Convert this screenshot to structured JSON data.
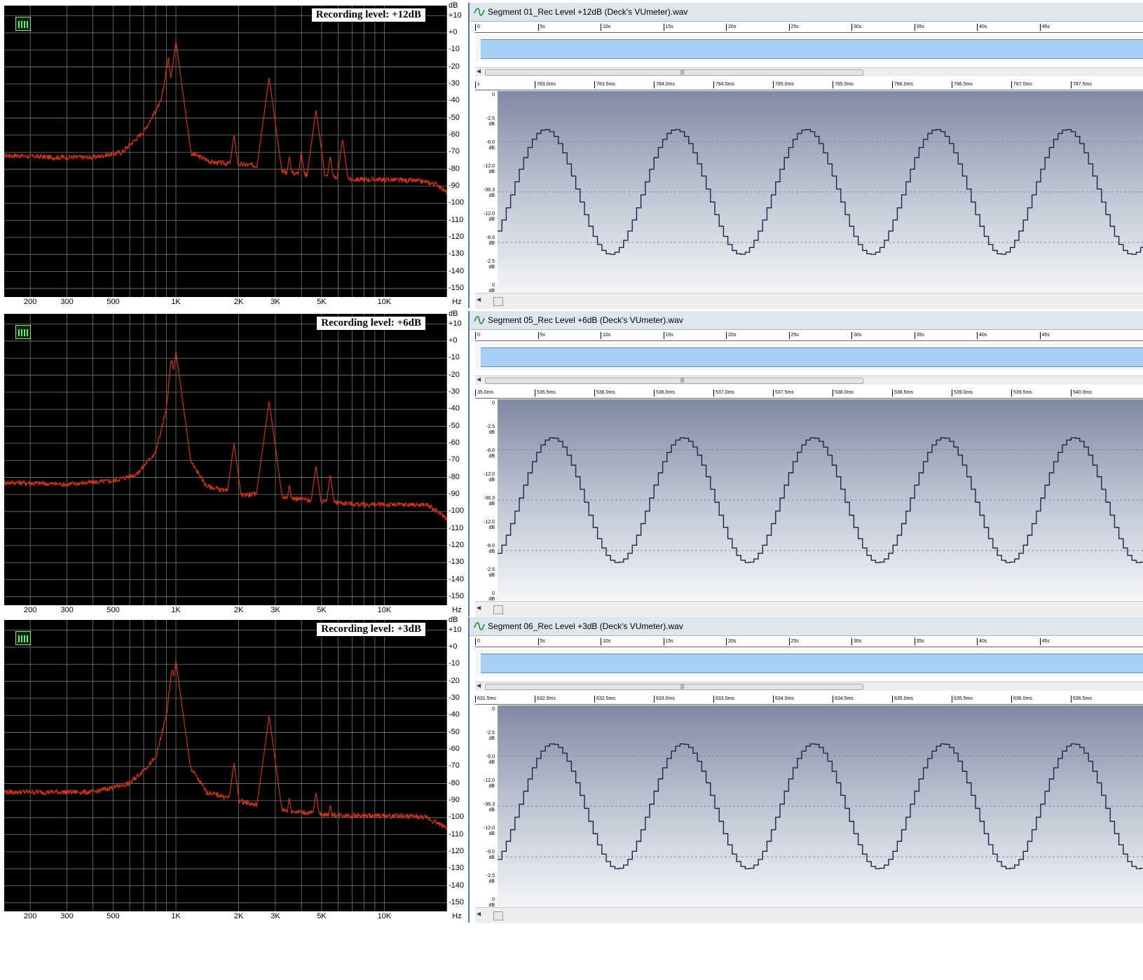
{
  "panels": [
    {
      "label": "Recording level: +12dB",
      "file": "Segment 01_Rec Level +12dB (Deck's VUmeter).wav",
      "detail_ruler": [
        "s",
        "783.0ms",
        "783.5ms",
        "784.0ms",
        "784.5ms",
        "785.0ms",
        "785.5ms",
        "786.0ms",
        "786.5ms",
        "787.0ms",
        "787.5ms"
      ],
      "spectrum": {
        "base": [
          [
            170,
            -72
          ],
          [
            250,
            -73
          ],
          [
            400,
            -73
          ],
          [
            550,
            -70
          ],
          [
            700,
            -58
          ],
          [
            850,
            -40
          ],
          [
            920,
            -15
          ],
          [
            980,
            -40
          ],
          [
            1150,
            -70
          ],
          [
            1500,
            -76
          ],
          [
            2500,
            -78
          ],
          [
            3500,
            -82
          ],
          [
            5000,
            -84
          ],
          [
            7000,
            -86
          ],
          [
            10000,
            -86
          ],
          [
            15000,
            -87
          ],
          [
            18000,
            -89
          ],
          [
            20000,
            -94
          ]
        ],
        "peaks": [
          [
            1000,
            -5
          ],
          [
            1900,
            -60
          ],
          [
            2800,
            -26
          ],
          [
            3500,
            -72
          ],
          [
            4000,
            -70
          ],
          [
            4700,
            -45
          ],
          [
            5500,
            -72
          ],
          [
            6300,
            -62
          ]
        ]
      }
    },
    {
      "label": "Recording level: +6dB",
      "file": "Segment 05_Rec Level +6dB (Deck's VUmeter).wav",
      "detail_ruler": [
        "35.0ms",
        "535.5ms",
        "536.0ms",
        "536.5ms",
        "537.0ms",
        "537.5ms",
        "538.0ms",
        "538.5ms",
        "539.0ms",
        "539.5ms",
        "540.0ms"
      ],
      "spectrum": {
        "base": [
          [
            170,
            -83
          ],
          [
            300,
            -84
          ],
          [
            500,
            -82
          ],
          [
            650,
            -78
          ],
          [
            800,
            -65
          ],
          [
            900,
            -40
          ],
          [
            950,
            -10
          ],
          [
            1000,
            -30
          ],
          [
            1100,
            -65
          ],
          [
            1400,
            -85
          ],
          [
            2000,
            -90
          ],
          [
            2500,
            -90
          ],
          [
            3500,
            -92
          ],
          [
            5000,
            -94
          ],
          [
            8000,
            -96
          ],
          [
            12000,
            -96
          ],
          [
            16000,
            -96
          ],
          [
            20000,
            -104
          ]
        ],
        "peaks": [
          [
            1000,
            -6
          ],
          [
            1900,
            -60
          ],
          [
            2800,
            -35
          ],
          [
            3500,
            -84
          ],
          [
            4700,
            -73
          ],
          [
            5500,
            -78
          ]
        ]
      }
    },
    {
      "label": "Recording level: +3dB",
      "file": "Segment 06_Rec Level +3dB (Deck's VUmeter).wav",
      "detail_ruler": [
        "631.5ms",
        "632.0ms",
        "632.5ms",
        "633.0ms",
        "633.5ms",
        "634.0ms",
        "634.5ms",
        "635.0ms",
        "635.5ms",
        "636.0ms",
        "636.5ms"
      ],
      "spectrum": {
        "base": [
          [
            170,
            -85
          ],
          [
            400,
            -85
          ],
          [
            600,
            -80
          ],
          [
            800,
            -65
          ],
          [
            900,
            -40
          ],
          [
            960,
            -12
          ],
          [
            1000,
            -30
          ],
          [
            1100,
            -65
          ],
          [
            1400,
            -85
          ],
          [
            2500,
            -93
          ],
          [
            3500,
            -96
          ],
          [
            5000,
            -98
          ],
          [
            8000,
            -99
          ],
          [
            12000,
            -99
          ],
          [
            16000,
            -100
          ],
          [
            20000,
            -106
          ]
        ],
        "peaks": [
          [
            1000,
            -8
          ],
          [
            1900,
            -68
          ],
          [
            2800,
            -40
          ],
          [
            3500,
            -88
          ],
          [
            4700,
            -85
          ],
          [
            5500,
            -92
          ]
        ]
      }
    }
  ],
  "spectrum_axis": {
    "y_ticks": [
      "dB",
      "+10",
      "+0",
      "-10",
      "-20",
      "-30",
      "-40",
      "-50",
      "-60",
      "-70",
      "-80",
      "-90",
      "-100",
      "-110",
      "-120",
      "-130",
      "-140",
      "-150"
    ],
    "x_ticks": [
      "200",
      "300",
      "500",
      "1K",
      "2K",
      "3K",
      "5K",
      "10K",
      "Hz"
    ],
    "trace_color": "#c8371a",
    "grid_color": "#7a7a7a"
  },
  "overview_ruler": [
    "0",
    "5s",
    "10s",
    "15s",
    "20s",
    "25s",
    "30s",
    "35s",
    "40s",
    "45s"
  ],
  "wave_yaxis": [
    {
      "value": "0",
      "unit": ""
    },
    {
      "value": "-2.5",
      "unit": "dB"
    },
    {
      "value": "-6.0",
      "unit": "dB"
    },
    {
      "value": "-12.0",
      "unit": "dB"
    },
    {
      "value": "-36.3",
      "unit": "dB"
    },
    {
      "value": "-12.0",
      "unit": "dB"
    },
    {
      "value": "-6.0",
      "unit": "dB"
    },
    {
      "value": "-2.5",
      "unit": "dB"
    },
    {
      "value": "0",
      "unit": "dB"
    }
  ],
  "colors": {
    "wave_line": "#1f2548",
    "overview_fill": "#a8d0f5",
    "title_bar": "#dfe6ee"
  },
  "icons": {
    "spectrum": "spectrum-analyzer-icon",
    "wave": "waveform-icon",
    "scroll_left": "scroll-left-arrow-icon"
  }
}
